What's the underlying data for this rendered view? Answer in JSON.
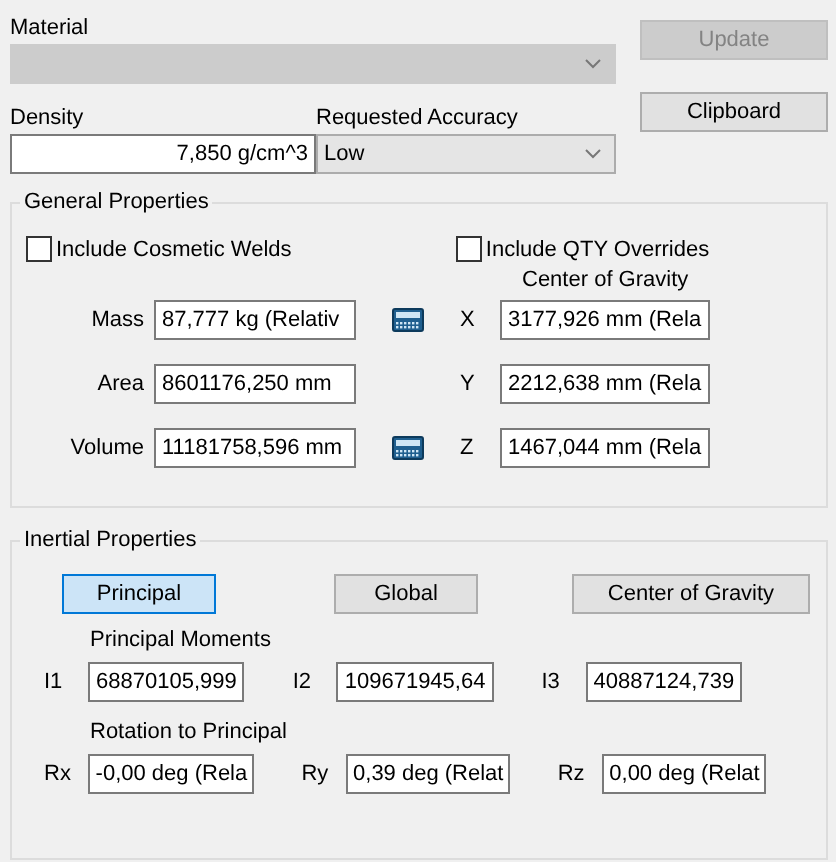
{
  "material": {
    "label": "Material",
    "disabled": true
  },
  "update_button": {
    "label": "Update",
    "disabled": true
  },
  "clipboard_button": {
    "label": "Clipboard",
    "disabled": false
  },
  "density": {
    "label": "Density",
    "value": "7,850 g/cm^3"
  },
  "accuracy": {
    "label": "Requested Accuracy",
    "value": "Low"
  },
  "general": {
    "title": "General Properties",
    "checkboxes": [
      {
        "label": "Include Cosmetic Welds",
        "checked": false
      },
      {
        "label": "Include QTY Overrides",
        "checked": false
      }
    ],
    "cog_title": "Center of Gravity",
    "rows": [
      {
        "label": "Mass",
        "value": "87,777 kg (Relativ",
        "calculator": true,
        "axis": "X",
        "cog": "3177,926 mm (Rela"
      },
      {
        "label": "Area",
        "value": "8601176,250 mm",
        "calculator": false,
        "axis": "Y",
        "cog": "2212,638 mm (Rela"
      },
      {
        "label": "Volume",
        "value": "11181758,596 mm",
        "calculator": true,
        "axis": "Z",
        "cog": "1467,044 mm (Rela"
      }
    ]
  },
  "inertial": {
    "title": "Inertial Properties",
    "buttons": [
      {
        "label": "Principal",
        "selected": true
      },
      {
        "label": "Global",
        "selected": false
      },
      {
        "label": "Center of Gravity",
        "selected": false
      }
    ],
    "moments_title": "Principal Moments",
    "moments": [
      {
        "label": "I1",
        "value": "68870105,999"
      },
      {
        "label": "I2",
        "value": "109671945,64"
      },
      {
        "label": "I3",
        "value": "40887124,739"
      }
    ],
    "rotation_title": "Rotation to Principal",
    "rotations": [
      {
        "label": "Rx",
        "value": "-0,00 deg (Rela"
      },
      {
        "label": "Ry",
        "value": "0,39 deg (Relat"
      },
      {
        "label": "Rz",
        "value": "0,00 deg (Relat"
      }
    ]
  }
}
